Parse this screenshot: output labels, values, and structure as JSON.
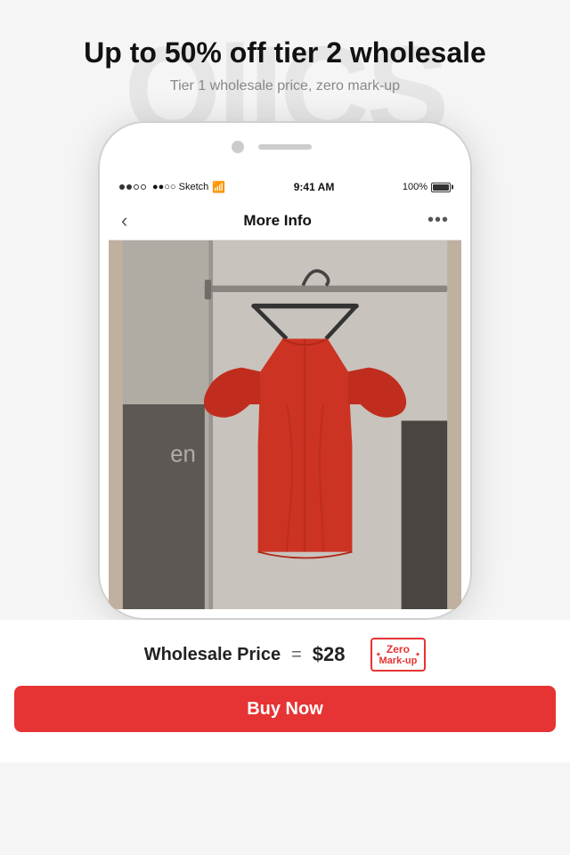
{
  "watermark": {
    "text": "OlICS"
  },
  "header": {
    "headline": "Up to 50% off tier 2 wholesale",
    "subheadline": "Tier 1 wholesale price, zero mark-up"
  },
  "phone": {
    "status_bar": {
      "carrier": "●●○○ Sketch",
      "wifi": "WiFi",
      "time": "9:41 AM",
      "battery_percent": "100%"
    },
    "nav": {
      "back_icon": "chevron-left",
      "title": "More Info",
      "more_icon": "ellipsis"
    }
  },
  "pricing": {
    "label": "Wholesale Price",
    "equals": "=",
    "price": "$28",
    "badge_line1": "Zero",
    "badge_line2": "Mark-up"
  },
  "cta": {
    "buy_label": "Buy Now"
  },
  "colors": {
    "accent": "#e63333",
    "text_primary": "#111111",
    "text_secondary": "#888888"
  }
}
